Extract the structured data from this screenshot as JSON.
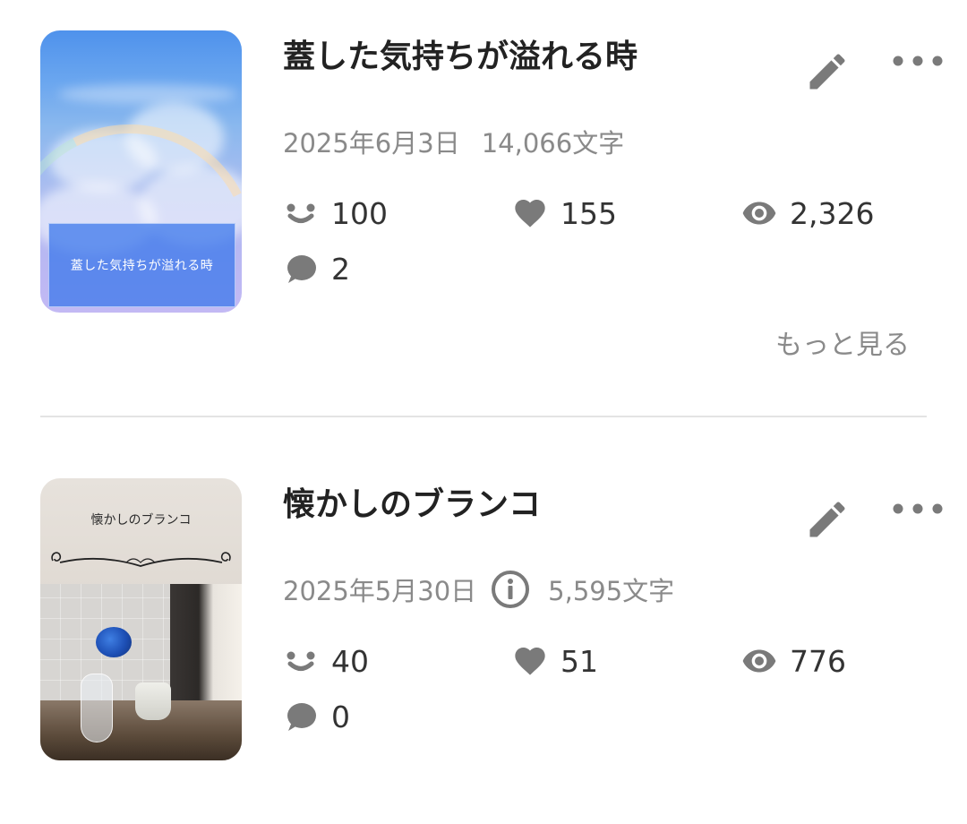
{
  "works": [
    {
      "title": "蓋した気持ちが溢れる時",
      "cover_text": "蓋した気持ちが溢れる時",
      "date": "2025年6月3日",
      "char_count": "14,066文字",
      "reactions": "100",
      "likes": "155",
      "views": "2,326",
      "comments": "2",
      "more_label": "もっと見る"
    },
    {
      "title": "懐かしのブランコ",
      "cover_text": "懐かしのブランコ",
      "date": "2025年5月30日",
      "char_count": "5,595文字",
      "reactions": "40",
      "likes": "51",
      "views": "776",
      "comments": "0"
    }
  ],
  "colors": {
    "text_primary": "#222222",
    "text_secondary": "#8a8a8a",
    "icon": "#7a7a7a",
    "divider": "#e4e4e4"
  },
  "icons": [
    "pencil-icon",
    "more-dots-icon",
    "smile-icon",
    "heart-icon",
    "eye-icon",
    "comment-icon",
    "info-icon"
  ]
}
